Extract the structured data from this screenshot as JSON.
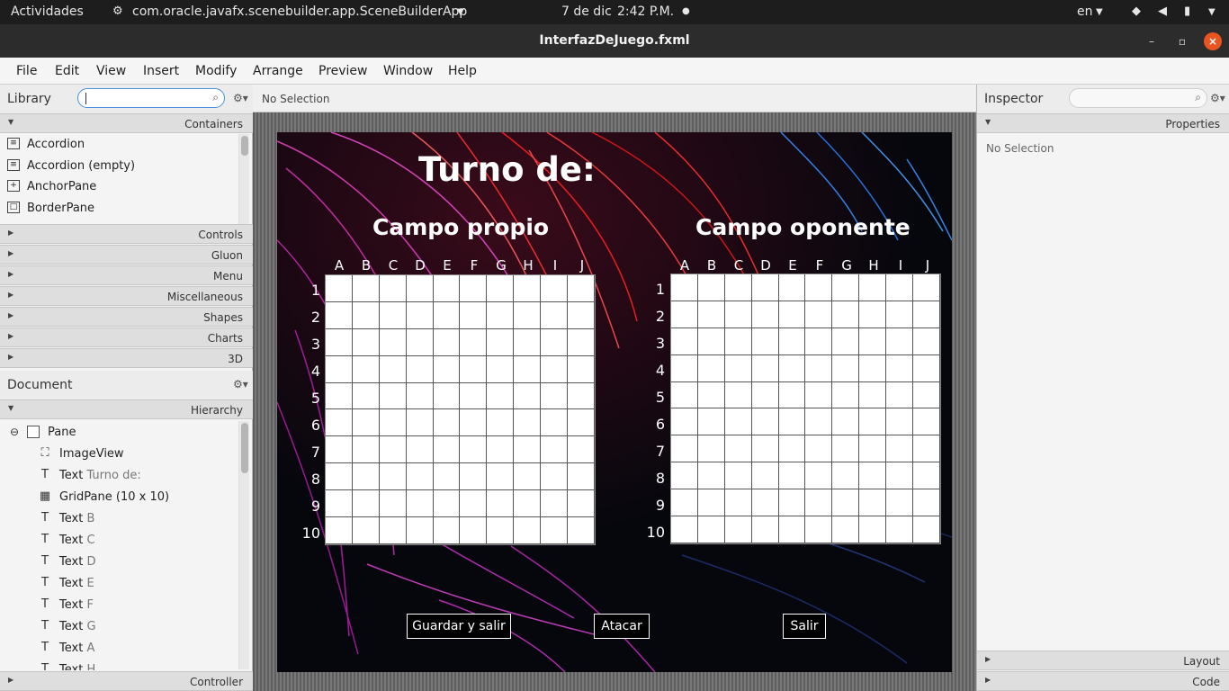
{
  "topbar": {
    "activities": "Actividades",
    "app_name": "com.oracle.javafx.scenebuilder.app.SceneBuilderApp",
    "date": "7 de dic",
    "time": "2:42 P.M.",
    "lang": "en"
  },
  "window": {
    "title": "InterfazDeJuego.fxml"
  },
  "menu": [
    "File",
    "Edit",
    "View",
    "Insert",
    "Modify",
    "Arrange",
    "Preview",
    "Window",
    "Help"
  ],
  "library": {
    "title": "Library",
    "search_value": "",
    "categories_open": "Containers",
    "items": [
      {
        "label": "Accordion",
        "icon": "accordion-icon"
      },
      {
        "label": "Accordion  (empty)",
        "icon": "accordion-icon"
      },
      {
        "label": "AnchorPane",
        "icon": "anchorpane-icon"
      },
      {
        "label": "BorderPane",
        "icon": "borderpane-icon"
      }
    ],
    "categories": [
      "Controls",
      "Gluon",
      "Menu",
      "Miscellaneous",
      "Shapes",
      "Charts",
      "3D"
    ]
  },
  "document": {
    "title": "Document",
    "section": "Hierarchy",
    "root": "Pane",
    "nodes": [
      {
        "type": "ImageView",
        "value": ""
      },
      {
        "type": "Text",
        "value": "Turno de:"
      },
      {
        "type": "GridPane (10 x 10)",
        "value": ""
      },
      {
        "type": "Text",
        "value": "B"
      },
      {
        "type": "Text",
        "value": "C"
      },
      {
        "type": "Text",
        "value": "D"
      },
      {
        "type": "Text",
        "value": "E"
      },
      {
        "type": "Text",
        "value": "F"
      },
      {
        "type": "Text",
        "value": "G"
      },
      {
        "type": "Text",
        "value": "A"
      },
      {
        "type": "Text",
        "value": "H"
      }
    ],
    "controller": "Controller"
  },
  "editor": {
    "selection": "No Selection",
    "game": {
      "turn_title": "Turno de:",
      "own_field": "Campo propio",
      "opponent_field": "Campo oponente",
      "columns": [
        "A",
        "B",
        "C",
        "D",
        "E",
        "F",
        "G",
        "H",
        "I",
        "J"
      ],
      "rows": [
        "1",
        "2",
        "3",
        "4",
        "5",
        "6",
        "7",
        "8",
        "9",
        "10"
      ],
      "buttons": {
        "save_exit": "Guardar y salir",
        "attack": "Atacar",
        "exit": "Salir"
      }
    }
  },
  "inspector": {
    "title": "Inspector",
    "section": "Properties",
    "selection": "No Selection",
    "layout": "Layout",
    "code": "Code"
  }
}
